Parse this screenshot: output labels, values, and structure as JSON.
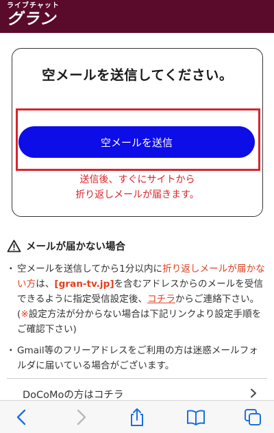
{
  "header": {
    "logo_sub": "ライブチャット",
    "logo_main": "グラン"
  },
  "card": {
    "title": "空メールを送信してください。",
    "button_label": "空メールを送信",
    "note_line1": "送信後、すぐにサイトから",
    "note_line2": "折り返しメールが届きます。"
  },
  "warning": {
    "heading": "メールが届かない場合",
    "bullet1": {
      "t1": "空メールを送信してから1分以内に",
      "t2": "折り返しメールが届かない方",
      "t3": "は、",
      "t4": "[gran-tv.jp]",
      "t5": "を含むアドレスからのメールを受信できるように指定受信設定後、",
      "t6": "コチラ",
      "t7": "からご連絡下さい。(",
      "t8": "※",
      "t9": "設定方法が分からない場合は下記リンクより設定手順をご確認下さい)"
    },
    "bullet2": "Gmail等のフリーアドレスをご利用の方は迷惑メールフォルダに届いている場合がございます。"
  },
  "links": {
    "docomo": "DoCoMoの方はコチラ"
  },
  "colors": {
    "header_bg": "#5a0a2a",
    "button_bg": "#0d0de8",
    "accent_red": "#d9242b",
    "link_blue": "#1a6fe0"
  },
  "icons": [
    "warning-icon",
    "chevron-right-icon",
    "back-icon",
    "forward-icon",
    "share-icon",
    "bookmarks-icon",
    "tabs-icon"
  ]
}
